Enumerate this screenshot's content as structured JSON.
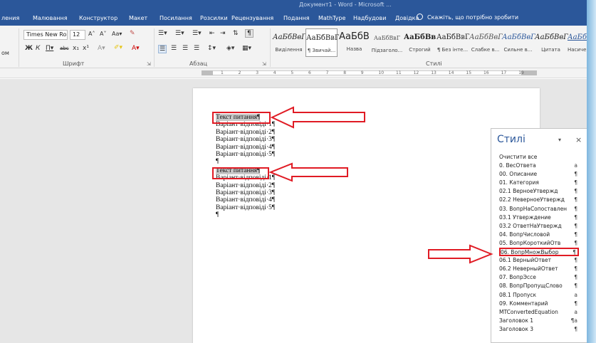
{
  "window": {
    "title": "Документ1 - Word - Microsoft ..."
  },
  "tabs": {
    "items": [
      "ления",
      "Малювання",
      "Конструктор",
      "Макет",
      "Посилання",
      "Розсилки",
      "Рецензування",
      "Подання",
      "MathType",
      "Надбудови",
      "Довідка"
    ],
    "tell_me": "Скажіть, що потрібно зробити"
  },
  "ribbon": {
    "font_name": "Times New Roma",
    "font_size": "12",
    "left_label": "ом",
    "groups": {
      "font": "Шрифт",
      "paragraph": "Абзац",
      "styles": "Стилі"
    },
    "style_gallery": [
      {
        "sample": "АаБбВвГ",
        "name": "Виділення"
      },
      {
        "sample": "АаБбВвГ",
        "name": "¶ Звичай..."
      },
      {
        "sample": "АаБбВ",
        "name": "Назва"
      },
      {
        "sample": "АаБбВвГ",
        "name": "Підзаголо..."
      },
      {
        "sample": "АаБбВв",
        "name": "Строгий"
      },
      {
        "sample": "АаБбВвГ",
        "name": "¶ Без інте..."
      },
      {
        "sample": "АаБбВвГ",
        "name": "Слабке в..."
      },
      {
        "sample": "АаБбВвГ",
        "name": "Сильне в..."
      },
      {
        "sample": "АаБбВвГ",
        "name": "Цитата"
      },
      {
        "sample": "АаБбВвГ",
        "name": "Насичена..."
      }
    ]
  },
  "ruler": {
    "numbers": [
      "1",
      "2",
      "3",
      "4",
      "5",
      "6",
      "7",
      "8",
      "9",
      "10",
      "11",
      "12",
      "13",
      "14",
      "15",
      "16",
      "17",
      "19"
    ]
  },
  "document": {
    "paragraphs": [
      {
        "text": "Текст питання¶",
        "highlighted": true
      },
      {
        "text": "Варіант·відповіді·1¶",
        "highlighted": false
      },
      {
        "text": "Варіант·відповіді·2¶",
        "highlighted": false
      },
      {
        "text": "Варіант·відповіді·3¶",
        "highlighted": false
      },
      {
        "text": "Варіант·відповіді·4¶",
        "highlighted": false
      },
      {
        "text": "Варіант·відповіді·5¶",
        "highlighted": false
      },
      {
        "text": "¶",
        "highlighted": false
      },
      {
        "text": "Текст питання¶",
        "highlighted": true
      },
      {
        "text": "Варіант·відповіді·1¶",
        "highlighted": false
      },
      {
        "text": "Варіант·відповіді·2¶",
        "highlighted": false
      },
      {
        "text": "Варіант·відповіді·3¶",
        "highlighted": false
      },
      {
        "text": "Варіант·відповіді·4¶",
        "highlighted": false
      },
      {
        "text": "Варіант·відповіді·5¶",
        "highlighted": false
      },
      {
        "text": "¶",
        "highlighted": false
      }
    ]
  },
  "styles_pane": {
    "title": "Стилі",
    "close": "×",
    "menu": "▾",
    "items": [
      {
        "name": "Очистити все",
        "symbol": ""
      },
      {
        "name": "0. ВесОтвета",
        "symbol": "a"
      },
      {
        "name": "00. Описание",
        "symbol": "¶"
      },
      {
        "name": "01. Категория",
        "symbol": "¶"
      },
      {
        "name": "02.1 ВерноеУтвержд",
        "symbol": "¶"
      },
      {
        "name": "02.2 НеверноеУтвержд",
        "symbol": "¶"
      },
      {
        "name": "03. ВопрНаСопоставлен",
        "symbol": "¶"
      },
      {
        "name": "03.1 Утверждение",
        "symbol": "¶"
      },
      {
        "name": "03.2 ОтветНаУтвержд",
        "symbol": "¶"
      },
      {
        "name": "04. ВопрЧисловой",
        "symbol": "¶"
      },
      {
        "name": "05. ВопрКороткийОтв",
        "symbol": "¶"
      },
      {
        "name": "06. ВопрМножВыбор",
        "symbol": "¶",
        "active": true
      },
      {
        "name": "06.1 ВерныйОтвет",
        "symbol": "¶"
      },
      {
        "name": "06.2 НеверныйОтвет",
        "symbol": "¶"
      },
      {
        "name": "07. ВопрЭссе",
        "symbol": "¶"
      },
      {
        "name": "08. ВопрПропущСлово",
        "symbol": "¶"
      },
      {
        "name": "08.1 Пропуск",
        "symbol": "a"
      },
      {
        "name": "09. Комментарий",
        "symbol": "¶"
      },
      {
        "name": "MTConvertedEquation",
        "symbol": "a"
      },
      {
        "name": "Заголовок 1",
        "symbol": "¶a"
      },
      {
        "name": "Заголовок 3",
        "symbol": "¶"
      }
    ]
  },
  "colors": {
    "ribbon_blue": "#2b579a",
    "annotation_red": "#e01b24",
    "highlight_gray": "#c8c8c8"
  }
}
